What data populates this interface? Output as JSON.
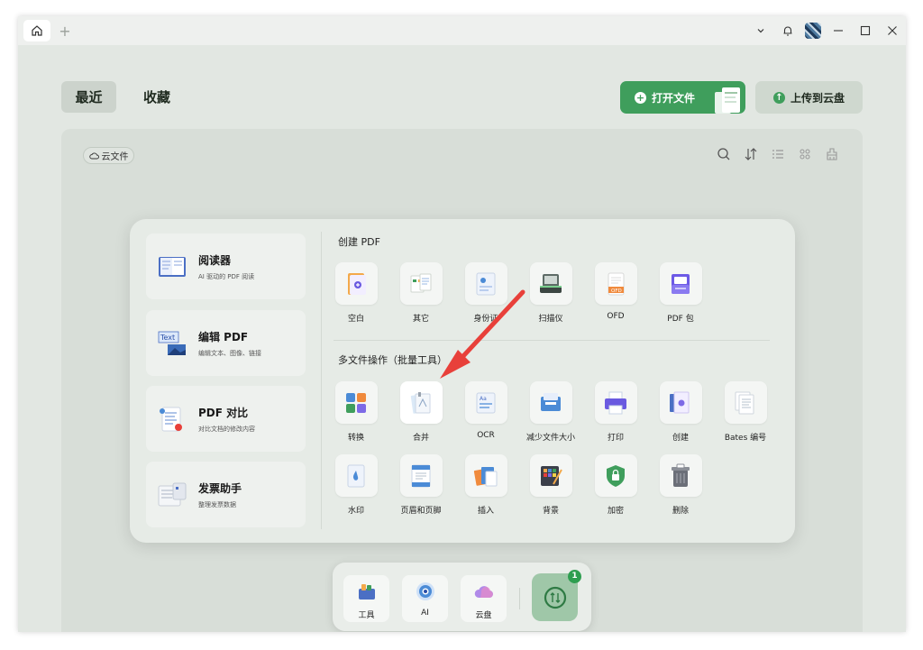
{
  "titlebar": {
    "home_icon": "home-icon",
    "add_tab": "+",
    "controls": [
      "chevron-down-icon",
      "bell-icon",
      "avatar",
      "minimize-icon",
      "maximize-icon",
      "close-icon"
    ]
  },
  "tabs": {
    "recent": "最近",
    "favorites": "收藏"
  },
  "actions": {
    "open_file": "打开文件",
    "upload_cloud": "上传到云盘"
  },
  "files": {
    "cloud_chip": "云文件"
  },
  "overlay": {
    "left_cards": [
      {
        "title": "阅读器",
        "subtitle": "AI 驱动的 PDF 阅读"
      },
      {
        "title": "编辑 PDF",
        "subtitle": "编辑文本、图像、链接"
      },
      {
        "title": "PDF 对比",
        "subtitle": "对比文档的修改内容"
      },
      {
        "title": "发票助手",
        "subtitle": "整理发票数据"
      }
    ],
    "create_title": "创建 PDF",
    "create_tools": [
      "空白",
      "其它",
      "身份证",
      "扫描仪",
      "OFD",
      "PDF 包"
    ],
    "multi_title": "多文件操作（批量工具）",
    "multi_tools_row1": [
      "转换",
      "合并",
      "OCR",
      "减少文件大小",
      "打印",
      "创建",
      "Bates 编号"
    ],
    "multi_tools_row2": [
      "水印",
      "页眉和页脚",
      "插入",
      "背景",
      "加密",
      "删除"
    ]
  },
  "dock": {
    "items": [
      "工具",
      "AI",
      "云盘"
    ],
    "sync_badge": "1"
  },
  "colors": {
    "accent": "#3f9e5c",
    "arrow": "#e8403a"
  }
}
